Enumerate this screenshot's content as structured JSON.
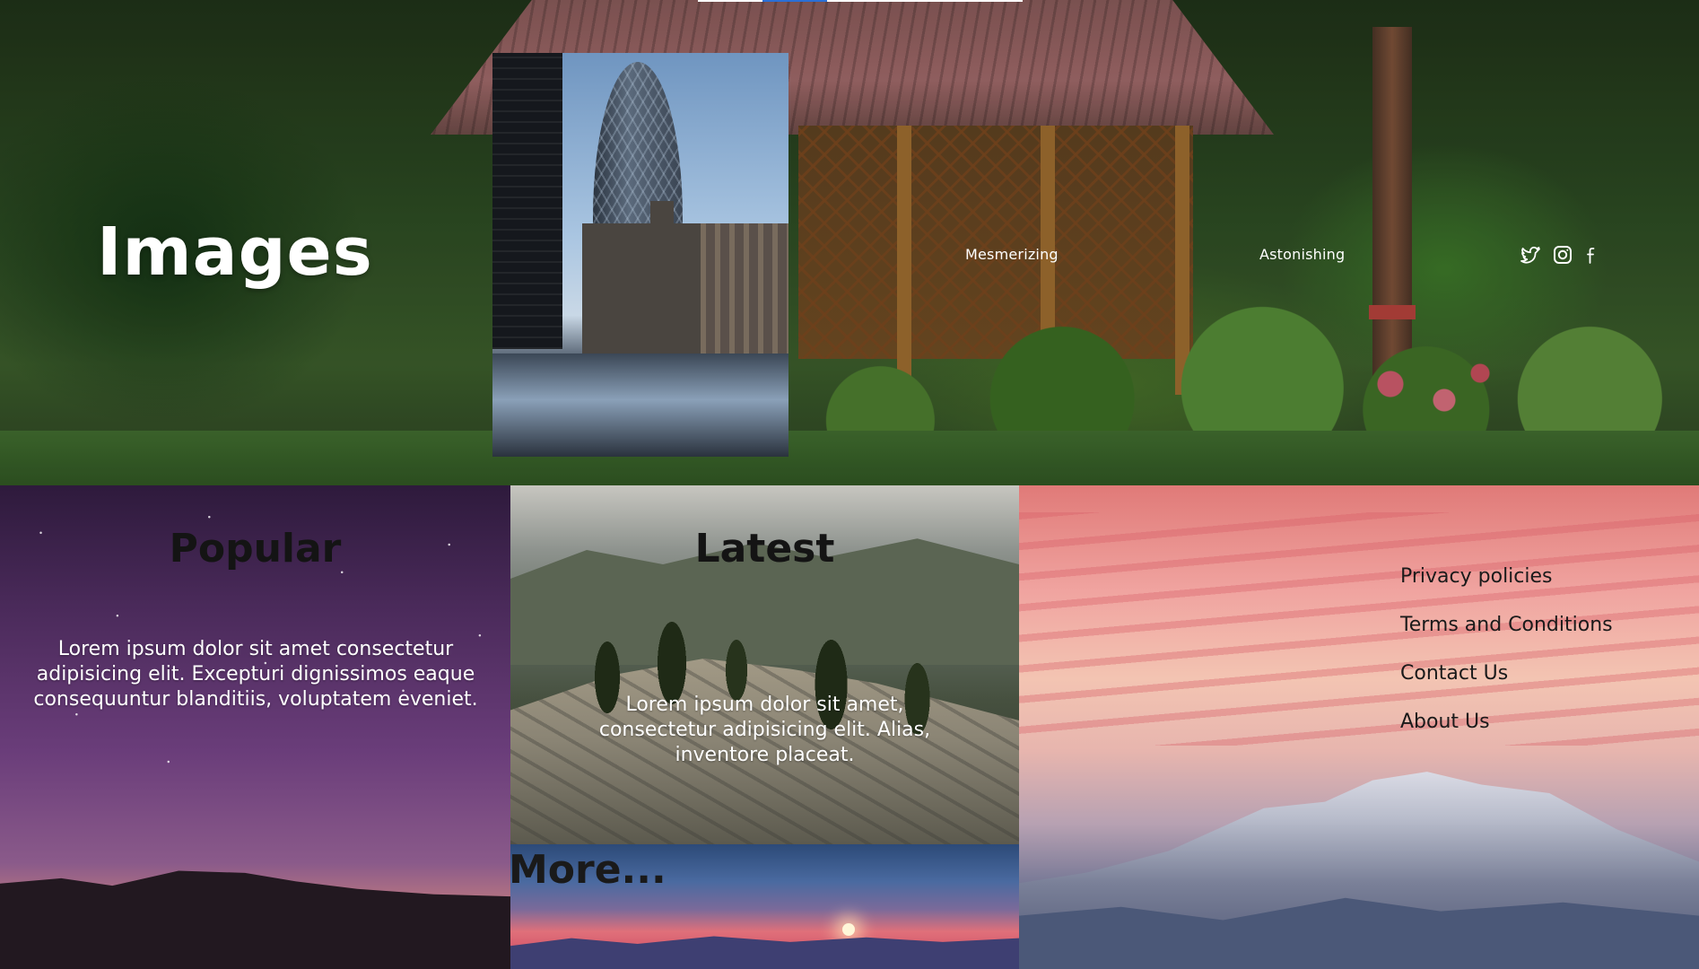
{
  "header": {
    "title": "Images",
    "nav": [
      {
        "label": "Mesmerizing"
      },
      {
        "label": "Astonishing"
      }
    ],
    "social": [
      {
        "icon": "twitter-icon"
      },
      {
        "icon": "instagram-icon"
      },
      {
        "icon": "facebook-icon"
      }
    ],
    "progress_fraction": 0.2
  },
  "sections": {
    "popular": {
      "title": "Popular",
      "text": "Lorem ipsum dolor sit amet consectetur adipisicing elit. Excepturi dignissimos eaque consequuntur blanditiis, voluptatem eveniet."
    },
    "latest": {
      "title": "Latest",
      "text": "Lorem ipsum dolor sit amet, consectetur adipisicing elit. Alias, inventore placeat."
    },
    "more": {
      "title": "More..."
    }
  },
  "footer_links": [
    {
      "label": "Privacy policies"
    },
    {
      "label": "Terms and Conditions"
    },
    {
      "label": "Contact Us"
    },
    {
      "label": "About Us"
    }
  ],
  "colors": {
    "heading_dark": "#141414",
    "text_light": "#ffffff",
    "progress_accent": "#2a6fd6"
  }
}
